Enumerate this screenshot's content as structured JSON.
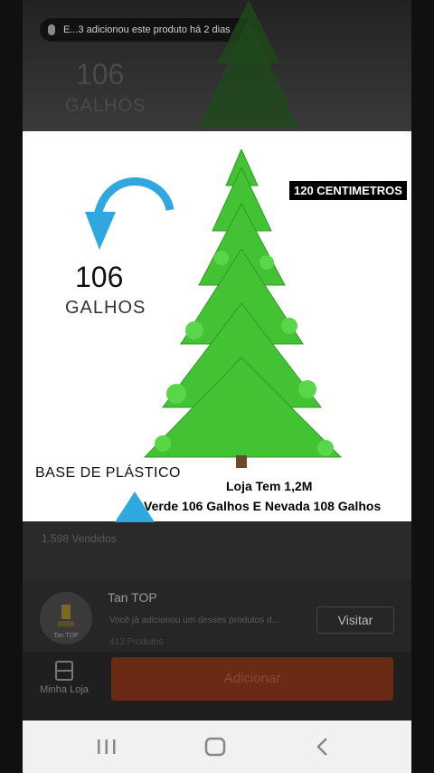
{
  "toast": {
    "text": "E...3 adicionou este produto há 2 dias"
  },
  "background_overlay": {
    "number": "106",
    "label": "GALHOS"
  },
  "photo": {
    "size_label": "120 CENTIMETROS",
    "branch_count": "106",
    "branch_label": "GALHOS",
    "base_label": "BASE DE PLÁSTICO",
    "store_line": "Loja Tem 1,2M",
    "variant_line": "Verde 106 Galhos E Nevada 108 Galhos"
  },
  "product": {
    "sold": "1.598 Vendidos"
  },
  "store": {
    "name": "Tan TOP",
    "subtitle": "Você já adicionou um desses produtos d...",
    "products_count": "413 Produtos",
    "visit_label": "Visitar",
    "avatar_label": "Tan TOP"
  },
  "actions": {
    "my_store_label": "Minha Loja",
    "add_label": "Adicionar"
  },
  "colors": {
    "arrow": "#2fa8e0",
    "tree": "#3fbf2f",
    "add_button": "#6b2a14"
  },
  "icons": {
    "my_store": "store-icon",
    "recent": "recent-apps-icon",
    "home": "home-icon",
    "back": "back-icon"
  }
}
